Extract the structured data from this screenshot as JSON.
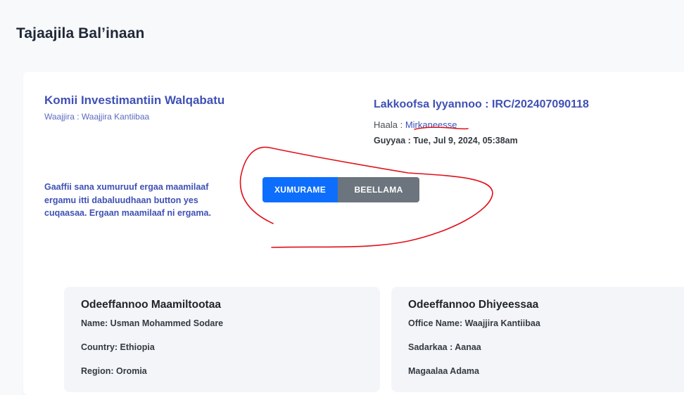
{
  "page_title": "Tajaajila Bal’inaan",
  "organization": {
    "name": "Komii Investimantiin Walqabatu",
    "office_line": "Waajjira : Waajjira Kantiibaa"
  },
  "application": {
    "number_label": "Lakkoofsa Iyyannoo : IRC/202407090118",
    "status_prefix": "Haala : ",
    "status_value": "Mirkaneesse",
    "date_line": "Guyyaa : Tue, Jul 9, 2024, 05:38am"
  },
  "instructions": "Gaaffii sana xumuruuf ergaa maamilaaf ergamu itti dabaluudhaan button yes cuqaasaa. Ergaan maamilaaf ni ergama.",
  "actions": {
    "confirm_label": "XUMURAME",
    "reject_label": "BEELLAMA"
  },
  "customer_info": {
    "title": "Odeeffannoo Maamiltootaa",
    "name": "Name: Usman Mohammed Sodare",
    "country": "Country: Ethiopia",
    "region": "Region: Oromia"
  },
  "provider_info": {
    "title": "Odeeffannoo Dhiyeessaa",
    "office_name": "Office Name: Waajjira Kantiibaa",
    "sector": "Sadarkaa : Aanaa",
    "city": "Magaalaa Adama"
  },
  "colors": {
    "accent": "#3f51b5",
    "confirm_button": "#0d6efd",
    "reject_button": "#6c757d",
    "annotation": "#e0101a"
  }
}
